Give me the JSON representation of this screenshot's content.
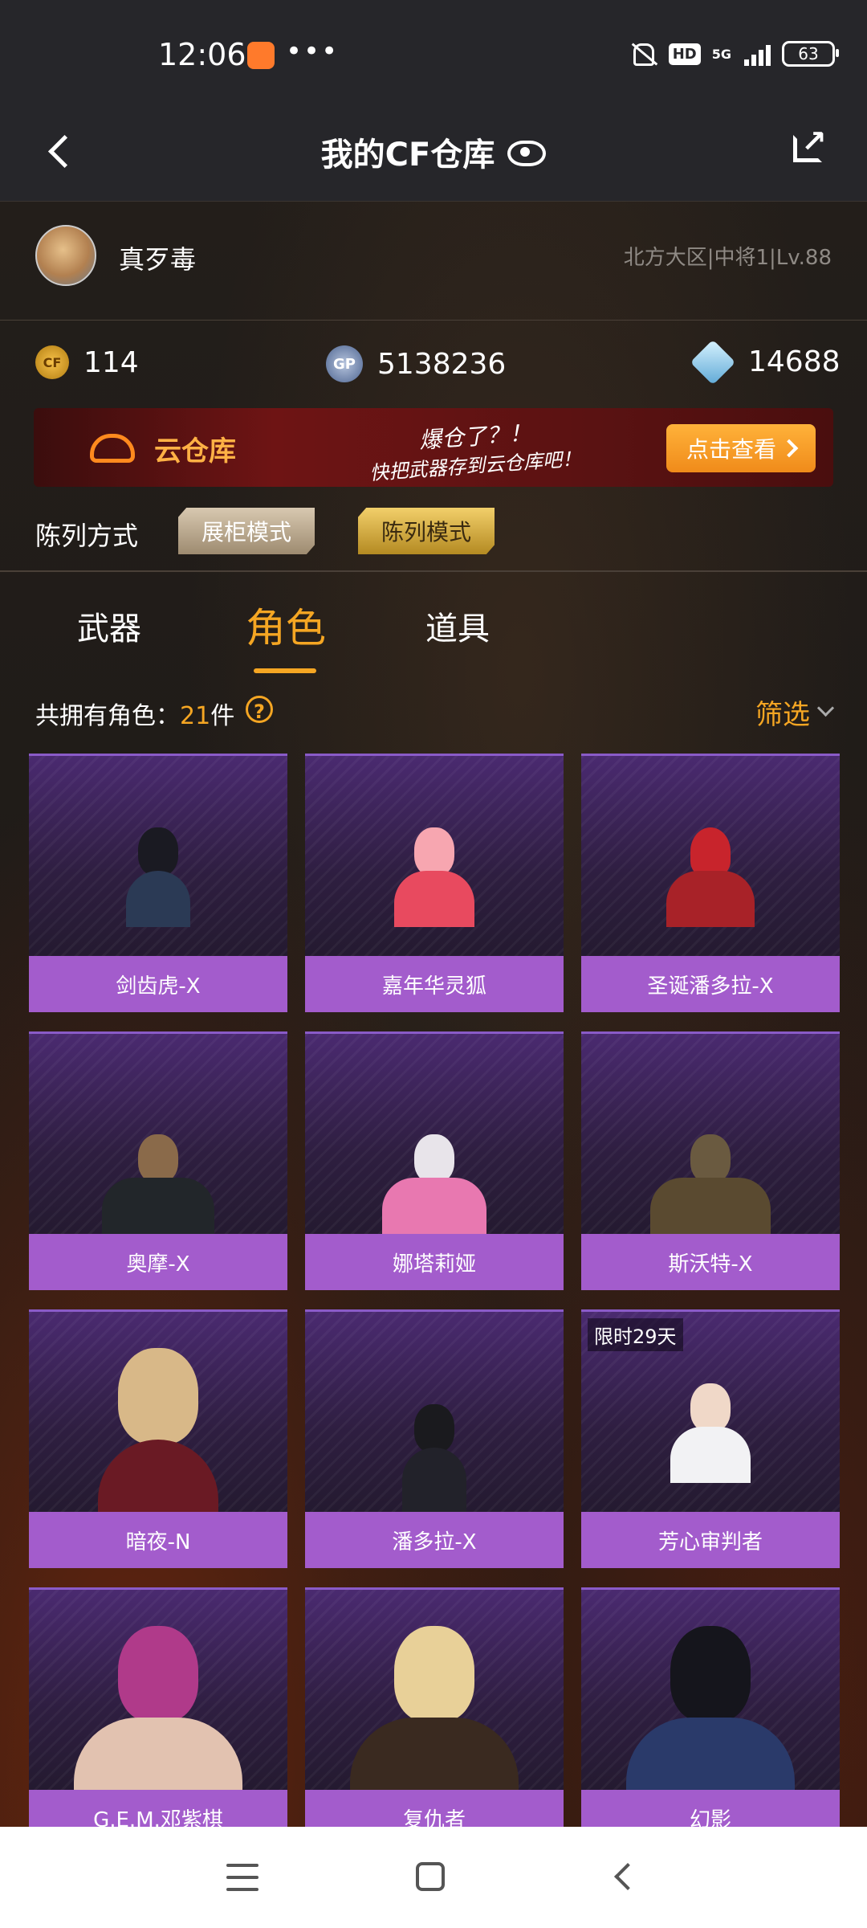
{
  "status_bar": {
    "time": "12:06",
    "dots": "•••",
    "hd": "HD",
    "network": "5G",
    "battery": "63"
  },
  "header": {
    "title": "我的CF仓库"
  },
  "profile": {
    "username": "真歹毒",
    "server": "北方大区|中将1|Lv.88"
  },
  "currency": {
    "cf_coin_label": "CF",
    "cf_coin": "114",
    "gp_label": "GP",
    "gp": "5138236",
    "diamond": "14688"
  },
  "banner": {
    "title": "云仓库",
    "slogan": "爆仓了？！",
    "subtitle": "快把武器存到云仓库吧！",
    "button": "点击查看"
  },
  "display": {
    "label": "陈列方式",
    "cabinet_mode": "展柜模式",
    "list_mode": "陈列模式"
  },
  "tabs": {
    "weapons": "武器",
    "roles": "角色",
    "items": "道具"
  },
  "count": {
    "prefix": "共拥有角色：",
    "number": "21",
    "suffix": "件",
    "help": "?",
    "filter": "筛选"
  },
  "roles": [
    {
      "name": "剑齿虎-X"
    },
    {
      "name": "嘉年华灵狐"
    },
    {
      "name": "圣诞潘多拉-X"
    },
    {
      "name": "奥摩-X"
    },
    {
      "name": "娜塔莉娅"
    },
    {
      "name": "斯沃特-X"
    },
    {
      "name": "暗夜-N"
    },
    {
      "name": "潘多拉-X"
    },
    {
      "name": "芳心审判者",
      "badge": "限时29天"
    },
    {
      "name": "G.E.M.邓紫棋"
    },
    {
      "name": "复仇者"
    },
    {
      "name": "幻影"
    }
  ],
  "colors": {
    "accent": "#f5a623",
    "card_label": "#a35ccc",
    "card_bg": "#3a2656"
  }
}
